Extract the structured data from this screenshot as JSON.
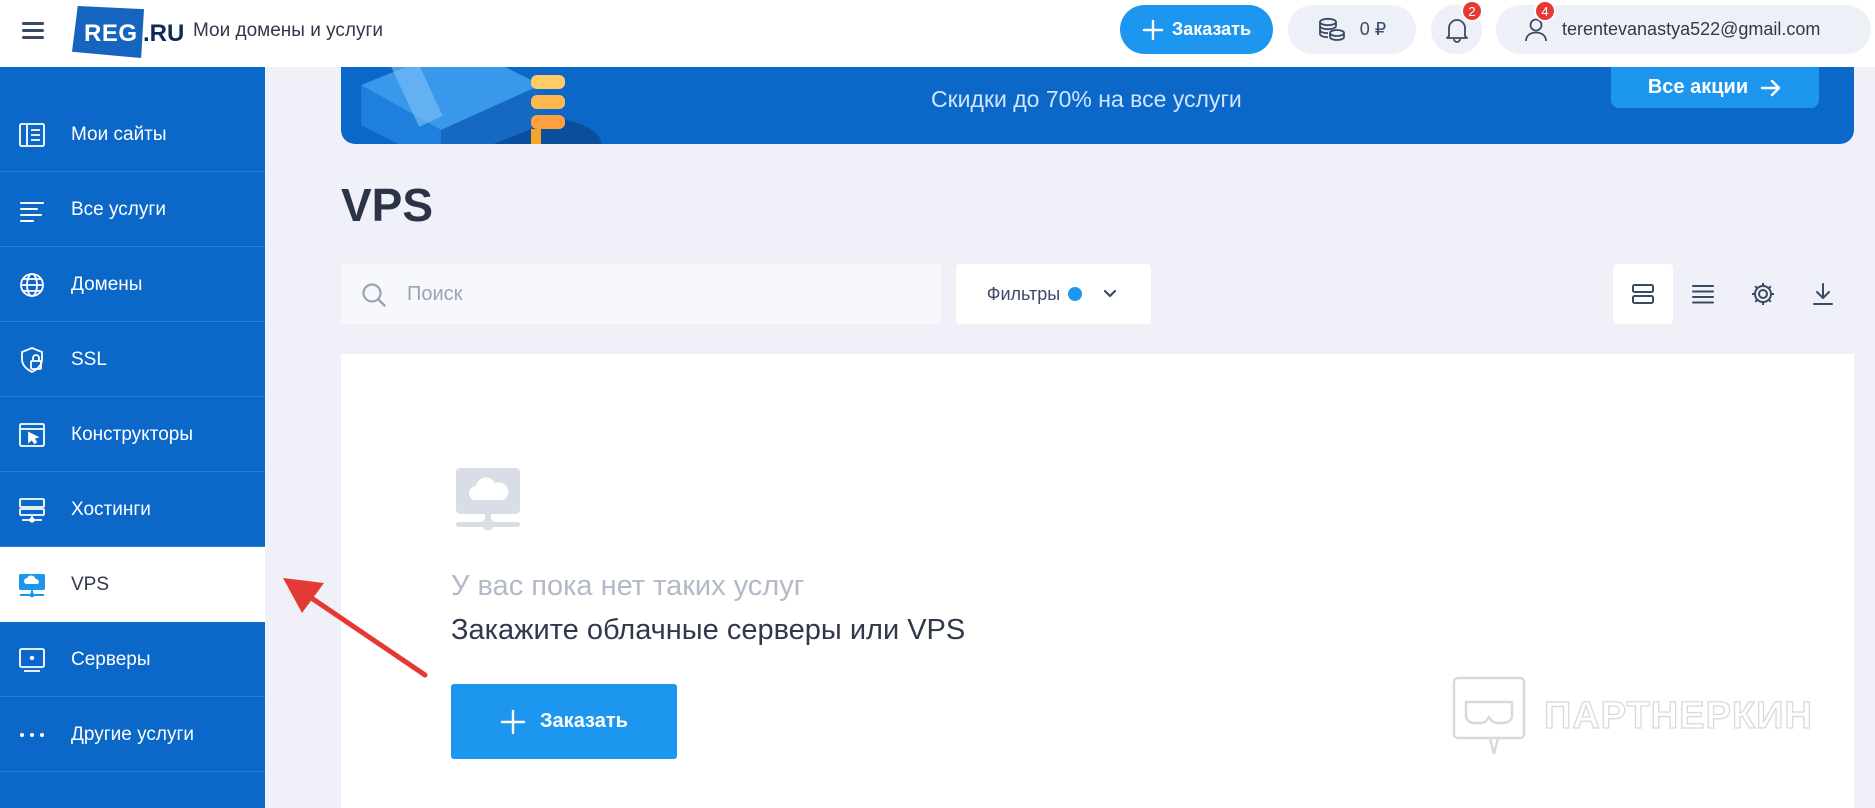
{
  "header": {
    "brand_part1": "REG",
    "brand_part2": ".RU",
    "brand_subtitle": "Мои домены и услуги",
    "order_label": "Заказать",
    "balance": "0 ₽",
    "notifications_count": "2",
    "user_count": "4",
    "user_email": "terentevanastya522@gmail.com"
  },
  "sidebar": {
    "items": [
      {
        "label": "Мои сайты",
        "icon": "sites-icon"
      },
      {
        "label": "Все услуги",
        "icon": "list-icon"
      },
      {
        "label": "Домены",
        "icon": "globe-icon"
      },
      {
        "label": "SSL",
        "icon": "shield-lock-icon"
      },
      {
        "label": "Конструкторы",
        "icon": "builder-icon"
      },
      {
        "label": "Хостинги",
        "icon": "hosting-icon"
      },
      {
        "label": "VPS",
        "icon": "vps-icon",
        "active": true
      },
      {
        "label": "Серверы",
        "icon": "server-icon"
      },
      {
        "label": "Другие услуги",
        "icon": "dots-icon"
      }
    ]
  },
  "banner": {
    "text": "Скидки до 70% на все услуги",
    "button_label": "Все акции"
  },
  "main": {
    "title": "VPS",
    "search_placeholder": "Поиск",
    "filters_label": "Фильтры",
    "empty_title": "У вас пока нет таких услуг",
    "empty_subtitle": "Закажите облачные серверы или VPS",
    "empty_button": "Заказать"
  },
  "watermark": "ПАРТНЕРКИН",
  "colors": {
    "brand_blue": "#0b68c8",
    "accent": "#1d96ef",
    "badge": "#e53935",
    "background": "#f0f1f8"
  }
}
